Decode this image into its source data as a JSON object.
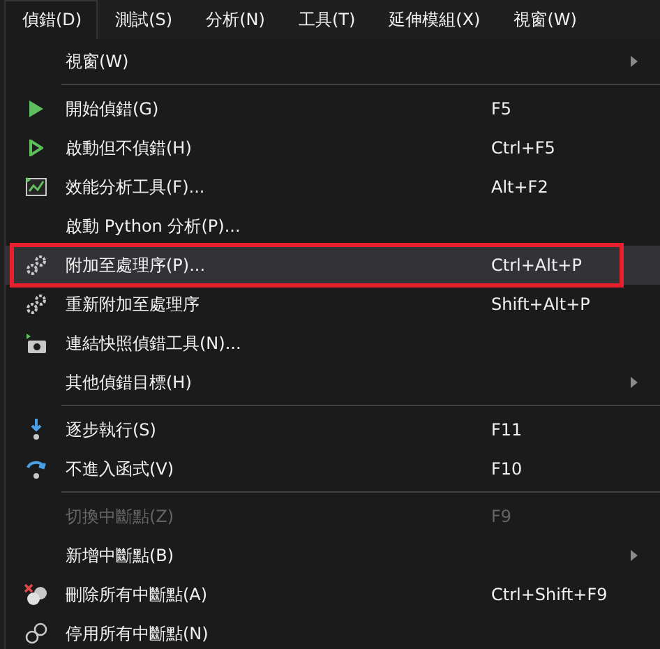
{
  "menubar": [
    {
      "label": "偵錯(D)",
      "selected": true
    },
    {
      "label": "測試(S)",
      "selected": false
    },
    {
      "label": "分析(N)",
      "selected": false
    },
    {
      "label": "工具(T)",
      "selected": false
    },
    {
      "label": "延伸模組(X)",
      "selected": false
    },
    {
      "label": "視窗(W)",
      "selected": false
    }
  ],
  "menu": [
    {
      "kind": "item",
      "label": "視窗(W)",
      "submenu": true,
      "selected": false,
      "disabled": false
    },
    {
      "kind": "separator"
    },
    {
      "kind": "item",
      "label": "開始偵錯(G)",
      "shortcut": "F5",
      "selected": false,
      "disabled": false
    },
    {
      "kind": "item",
      "label": "啟動但不偵錯(H)",
      "shortcut": "Ctrl+F5",
      "selected": false,
      "disabled": false
    },
    {
      "kind": "item",
      "label": "效能分析工具(F)...",
      "shortcut": "Alt+F2",
      "selected": false,
      "disabled": false
    },
    {
      "kind": "item",
      "label": "啟動 Python 分析(P)...",
      "selected": false,
      "disabled": false
    },
    {
      "kind": "item",
      "label": "附加至處理序(P)...",
      "shortcut": "Ctrl+Alt+P",
      "selected": true,
      "disabled": false,
      "outlined": true
    },
    {
      "kind": "item",
      "label": "重新附加至處理序",
      "shortcut": "Shift+Alt+P",
      "selected": false,
      "disabled": false
    },
    {
      "kind": "item",
      "label": "連結快照偵錯工具(N)...",
      "selected": false,
      "disabled": false
    },
    {
      "kind": "item",
      "label": "其他偵錯目標(H)",
      "submenu": true,
      "selected": false,
      "disabled": false
    },
    {
      "kind": "separator"
    },
    {
      "kind": "item",
      "label": "逐步執行(S)",
      "shortcut": "F11",
      "selected": false,
      "disabled": false
    },
    {
      "kind": "item",
      "label": "不進入函式(V)",
      "shortcut": "F10",
      "selected": false,
      "disabled": false
    },
    {
      "kind": "separator"
    },
    {
      "kind": "item",
      "label": "切換中斷點(Z)",
      "shortcut": "F9",
      "selected": false,
      "disabled": true
    },
    {
      "kind": "item",
      "label": "新增中斷點(B)",
      "submenu": true,
      "selected": false,
      "disabled": false
    },
    {
      "kind": "item",
      "label": "刪除所有中斷點(A)",
      "shortcut": "Ctrl+Shift+F9",
      "selected": false,
      "disabled": false
    },
    {
      "kind": "item",
      "label": "停用所有中斷點(N)",
      "selected": false,
      "disabled": false
    }
  ]
}
